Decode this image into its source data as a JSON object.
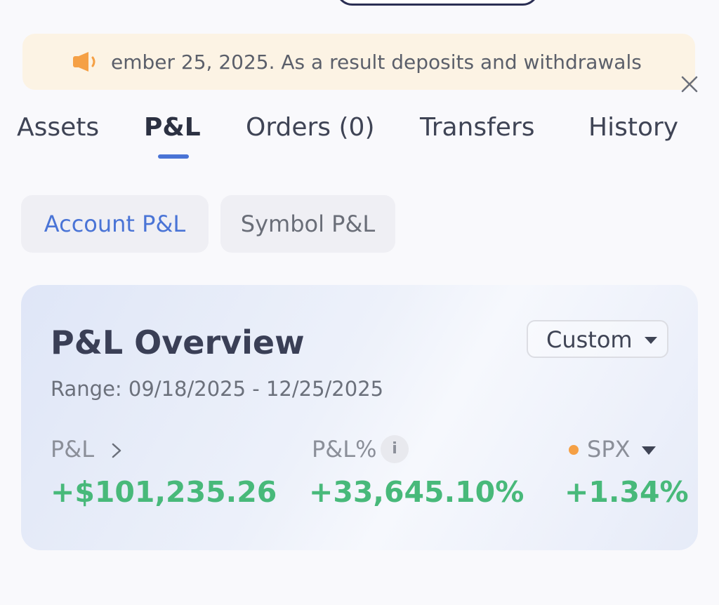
{
  "banner": {
    "message": "ember 25, 2025. As a result deposits and withdrawals",
    "speaker_icon": "speaker-icon",
    "close_icon": "close-icon",
    "speaker_color": "#f5a045"
  },
  "tabs": [
    {
      "label": "Assets"
    },
    {
      "label": "P&L"
    },
    {
      "label": "Orders (0)"
    },
    {
      "label": "Transfers"
    },
    {
      "label": "History"
    }
  ],
  "active_tab": "P&L",
  "segments": {
    "account": "Account P&L",
    "symbol": "Symbol P&L"
  },
  "overview": {
    "title": "P&L Overview",
    "range_select": "Custom",
    "range_text": "Range: 09/18/2025 - 12/25/2025",
    "pnl_label": "P&L",
    "pnl_value": "+$101,235.26",
    "pnl_pct_label": "P&L%",
    "pnl_pct_value": "+33,645.10%",
    "info_glyph": "i",
    "benchmark_label": "SPX",
    "benchmark_value": "+1.34%"
  },
  "colors": {
    "accent": "#4a74d6",
    "positive": "#48b97a",
    "benchmark_dot": "#f5a045"
  }
}
